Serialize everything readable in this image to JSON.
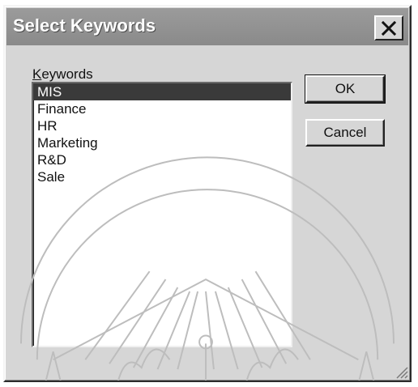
{
  "window": {
    "title": "Select Keywords"
  },
  "icons": {
    "close": "close-icon",
    "resize": "resize-grip-icon"
  },
  "keywords": {
    "label_accel": "K",
    "label_rest": "eywords",
    "items": [
      "MIS",
      "Finance",
      "HR",
      "Marketing",
      "R&D",
      "Sale"
    ],
    "selected": "MIS"
  },
  "buttons": {
    "ok": "OK",
    "cancel": "Cancel"
  }
}
